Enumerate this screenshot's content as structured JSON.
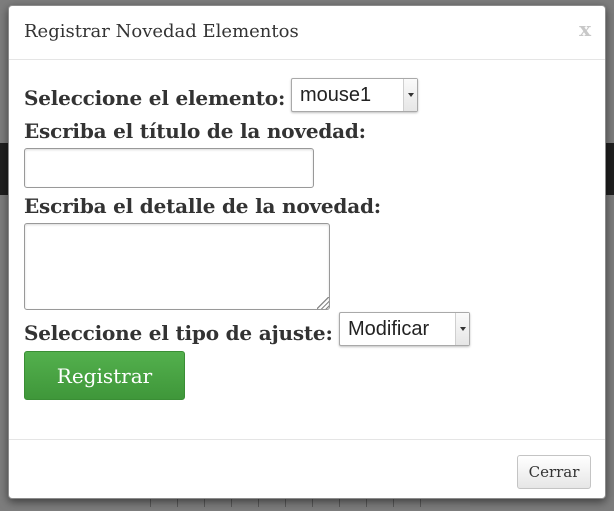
{
  "modal": {
    "title": "Registrar Novedad Elementos",
    "close_glyph": "x"
  },
  "form": {
    "element_label": "Seleccione el elemento:",
    "element_value": "mouse1",
    "title_label": "Escriba el título de la novedad:",
    "title_value": "",
    "detail_label": "Escriba el detalle de la novedad:",
    "detail_value": "",
    "adjust_label": "Seleccione el tipo de ajuste:",
    "adjust_value": "Modificar",
    "submit_label": "Registrar"
  },
  "footer": {
    "close_label": "Cerrar"
  },
  "colors": {
    "primary": "#47a341",
    "overlay": "#7d7d7d"
  }
}
